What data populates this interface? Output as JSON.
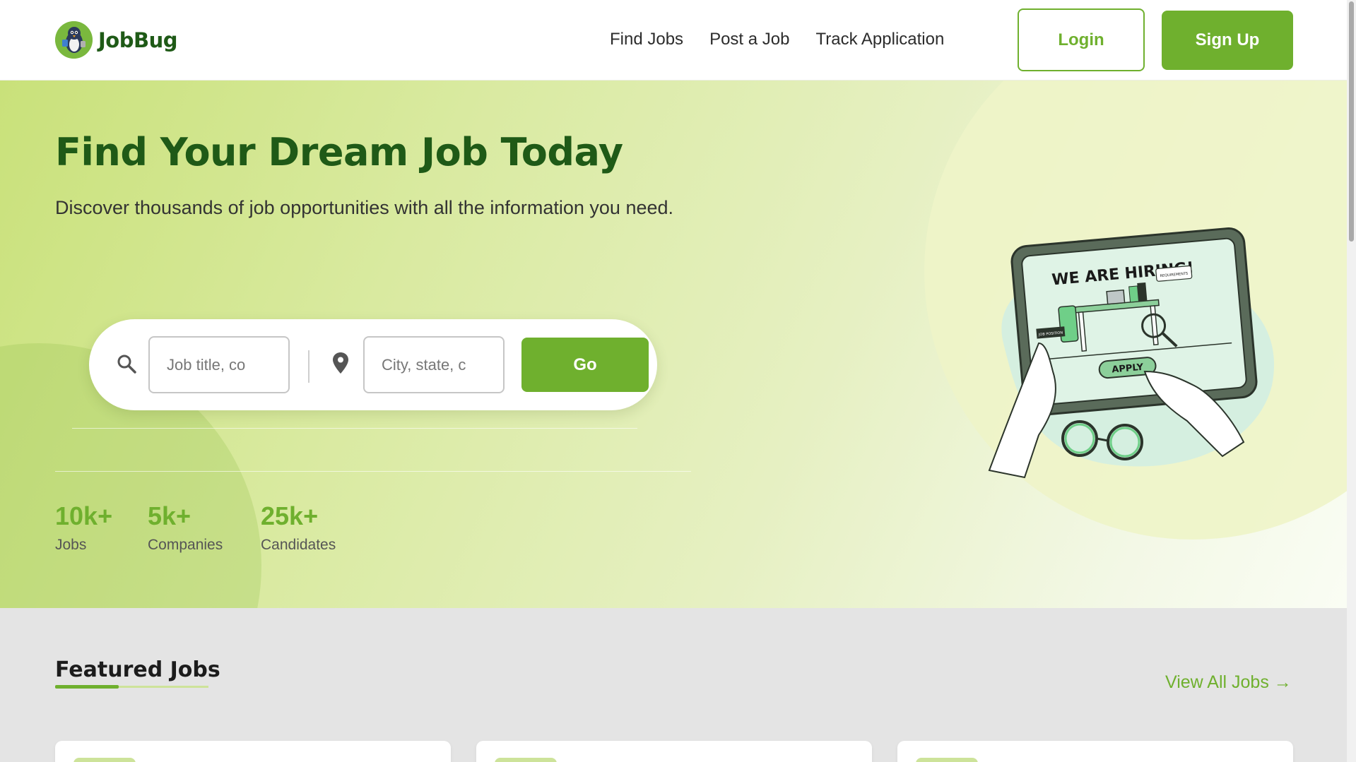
{
  "header": {
    "logo_text": "JobBug",
    "nav": [
      "Find Jobs",
      "Post a Job",
      "Track Application"
    ],
    "login_label": "Login",
    "signup_label": "Sign Up"
  },
  "hero": {
    "title": "Find Your Dream Job Today",
    "subtitle": "Discover thousands of job opportunities with all the information you need.",
    "search": {
      "job_placeholder": "Job title, co",
      "location_placeholder": "City, state, c",
      "go_label": "Go"
    },
    "stats": [
      {
        "value": "10k+",
        "label": "Jobs"
      },
      {
        "value": "5k+",
        "label": "Companies"
      },
      {
        "value": "25k+",
        "label": "Candidates"
      }
    ],
    "illustration": {
      "heading": "WE ARE HIRING!",
      "button": "APPLY",
      "tag1": "JOB POSITION",
      "tag2": "REQUIREMENTS"
    }
  },
  "featured": {
    "title": "Featured Jobs",
    "view_all": "View All Jobs →"
  },
  "colors": {
    "brand_green": "#6fb02e",
    "dark_green": "#1f5a17"
  }
}
